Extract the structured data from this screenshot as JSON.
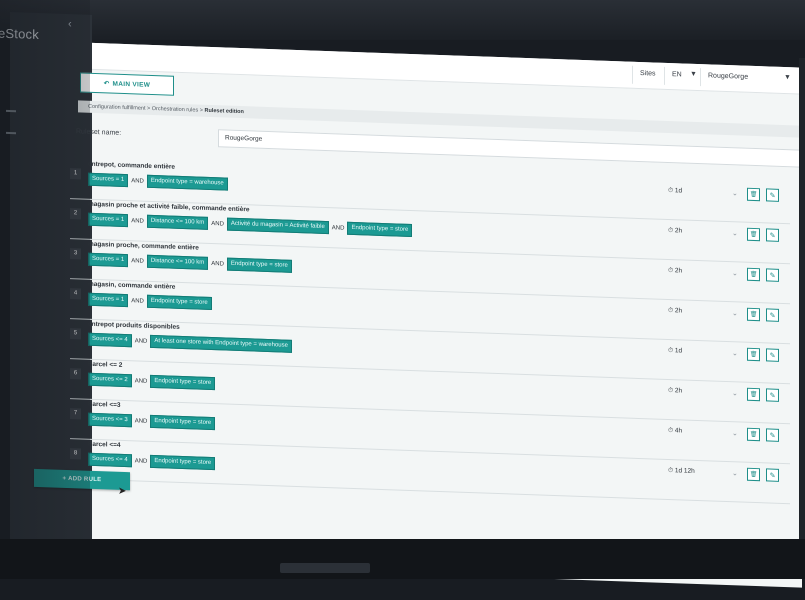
{
  "app": {
    "brand": "eStock"
  },
  "topbar": {
    "sites_label": "Sites",
    "lang": "EN",
    "store": "RougeGorge"
  },
  "main_view_label": "MAIN VIEW",
  "breadcrumb": {
    "trail": "Configuration fulfillment > Orchestration rules > ",
    "current": "Ruleset edition"
  },
  "ruleset": {
    "label": "Ruleset name:",
    "value": "RougeGorge"
  },
  "rules": [
    {
      "num": "1",
      "title": "entrepot, commande entière",
      "conditions": [
        "Sources = 1",
        "AND",
        "Endpoint type = warehouse"
      ],
      "delay": "1d"
    },
    {
      "num": "2",
      "title": "magasin proche et activité faible, commande entière",
      "conditions": [
        "Sources = 1",
        "AND",
        "Distance <= 100 km",
        "AND",
        "Activité du magasin = Activité faible",
        "AND",
        "Endpoint type = store"
      ],
      "delay": "2h"
    },
    {
      "num": "3",
      "title": "magasin proche, commande entière",
      "conditions": [
        "Sources = 1",
        "AND",
        "Distance <= 100 km",
        "AND",
        "Endpoint type = store"
      ],
      "delay": "2h"
    },
    {
      "num": "4",
      "title": "magasin, commande entière",
      "conditions": [
        "Sources = 1",
        "AND",
        "Endpoint type = store"
      ],
      "delay": "2h"
    },
    {
      "num": "5",
      "title": "entrepot produits disponibles",
      "conditions": [
        "Sources <= 4",
        "AND",
        "At least one store with Endpoint type = warehouse"
      ],
      "delay": "1d"
    },
    {
      "num": "6",
      "title": "Parcel <= 2",
      "conditions": [
        "Sources <= 2",
        "AND",
        "Endpoint type = store"
      ],
      "delay": "2h"
    },
    {
      "num": "7",
      "title": "Parcel <=3",
      "conditions": [
        "Sources <= 3",
        "AND",
        "Endpoint type = store"
      ],
      "delay": "4h"
    },
    {
      "num": "8",
      "title": "Parcel <=4",
      "conditions": [
        "Sources <= 4",
        "AND",
        "Endpoint type = store"
      ],
      "delay": "1d 12h"
    }
  ],
  "add_rule_label": "+ ADD RULE",
  "icons": {
    "clock": "clock-icon",
    "chevron": "chevron-down-icon",
    "delete": "trash-icon",
    "edit": "pencil-icon"
  },
  "colors": {
    "accent": "#1c9a93",
    "sidebar": "#2c3239",
    "badge": "#3a4048"
  }
}
